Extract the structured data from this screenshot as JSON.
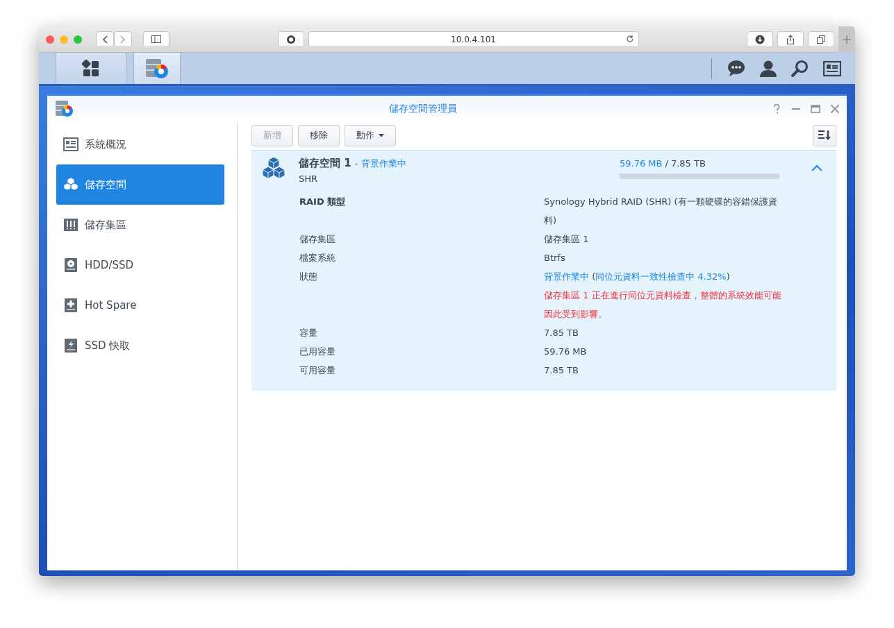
{
  "browser": {
    "url": "10.0.4.101"
  },
  "taskbar": {
    "apps": [
      {
        "kind": "main-menu",
        "selected": false
      },
      {
        "kind": "storage-manager",
        "selected": true
      }
    ]
  },
  "window": {
    "title": "儲存空間管理員"
  },
  "sidebar": {
    "items": [
      {
        "label": "系統概況",
        "kind": "overview",
        "selected": false
      },
      {
        "label": "儲存空間",
        "kind": "volume",
        "selected": true
      },
      {
        "label": "儲存集區",
        "kind": "pool",
        "selected": false
      },
      {
        "label": "HDD/SSD",
        "kind": "disk",
        "selected": false
      },
      {
        "label": "Hot Spare",
        "kind": "spare",
        "selected": false
      },
      {
        "label": "SSD 快取",
        "kind": "cache",
        "selected": false
      }
    ]
  },
  "toolbar": {
    "buttons": [
      {
        "label": "新增",
        "disabled": true,
        "dropdown": false
      },
      {
        "label": "移除",
        "disabled": false,
        "dropdown": false
      },
      {
        "label": "動作",
        "disabled": false,
        "dropdown": true
      }
    ]
  },
  "volume": {
    "name": "儲存空間 1",
    "dash": "-",
    "status": "背景作業中",
    "type": "SHR",
    "expanded": true,
    "usage": {
      "used": "59.76 MB",
      "separator": "/",
      "total": "7.85 TB",
      "level": 0.0
    },
    "details": [
      {
        "kind": "text",
        "label": "RAID 類型",
        "value": "Synology Hybrid RAID (SHR) (有一顆硬碟的容錯保護資料)"
      },
      {
        "kind": "text",
        "label": "儲存集區",
        "value": "儲存集區 1"
      },
      {
        "kind": "text",
        "label": "檔案系統",
        "value": "Btrfs"
      },
      {
        "kind": "status",
        "label": "狀態",
        "segments": [
          {
            "text": "背景作業中 ",
            "highlight": true
          },
          {
            "text": "(",
            "highlight": false
          },
          {
            "text": "同位元資料一致性檢查中 4.32%",
            "highlight": true
          },
          {
            "text": ")",
            "highlight": false
          }
        ]
      },
      {
        "kind": "warning",
        "value": "儲存集區 1 正在進行同位元資料檢查，整體的系統效能可能因此受到影響。"
      },
      {
        "kind": "text",
        "label": "容量",
        "value": "7.85 TB"
      },
      {
        "kind": "text",
        "label": "已用容量",
        "value": "59.76 MB"
      },
      {
        "kind": "text",
        "label": "可用容量",
        "value": "7.85 TB"
      }
    ]
  }
}
